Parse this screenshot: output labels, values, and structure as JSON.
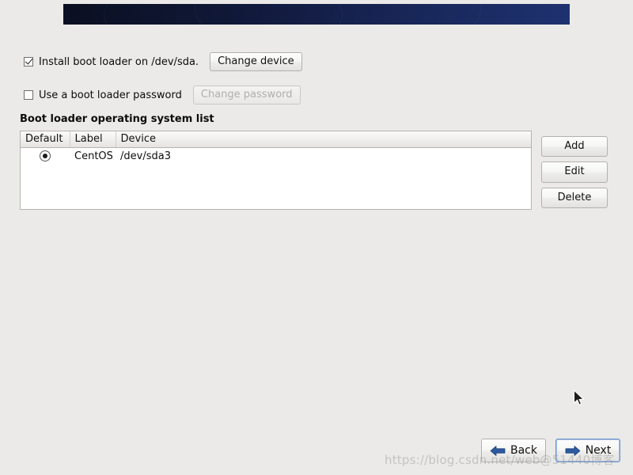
{
  "banner": {
    "gradient_start": "#0a0f22",
    "gradient_end": "#1e3270"
  },
  "options": {
    "install_bootloader": {
      "label": "Install boot loader on /dev/sda.",
      "checked": true,
      "button_label": "Change device",
      "button_disabled": false
    },
    "bootloader_password": {
      "label": "Use a boot loader password",
      "checked": false,
      "button_label": "Change password",
      "button_disabled": true
    }
  },
  "os_list": {
    "heading": "Boot loader operating system list",
    "columns": [
      "Default",
      "Label",
      "Device"
    ],
    "rows": [
      {
        "default": true,
        "label": "CentOS",
        "device": "/dev/sda3"
      }
    ],
    "side_buttons": [
      {
        "label": "Add"
      },
      {
        "label": "Edit"
      },
      {
        "label": "Delete"
      }
    ]
  },
  "nav": {
    "back_label": "Back",
    "next_label": "Next",
    "arrow_color": "#2c5aa0",
    "next_focused": true
  },
  "watermark": {
    "text": "https://blog.csdn.net/web@51440博客"
  }
}
